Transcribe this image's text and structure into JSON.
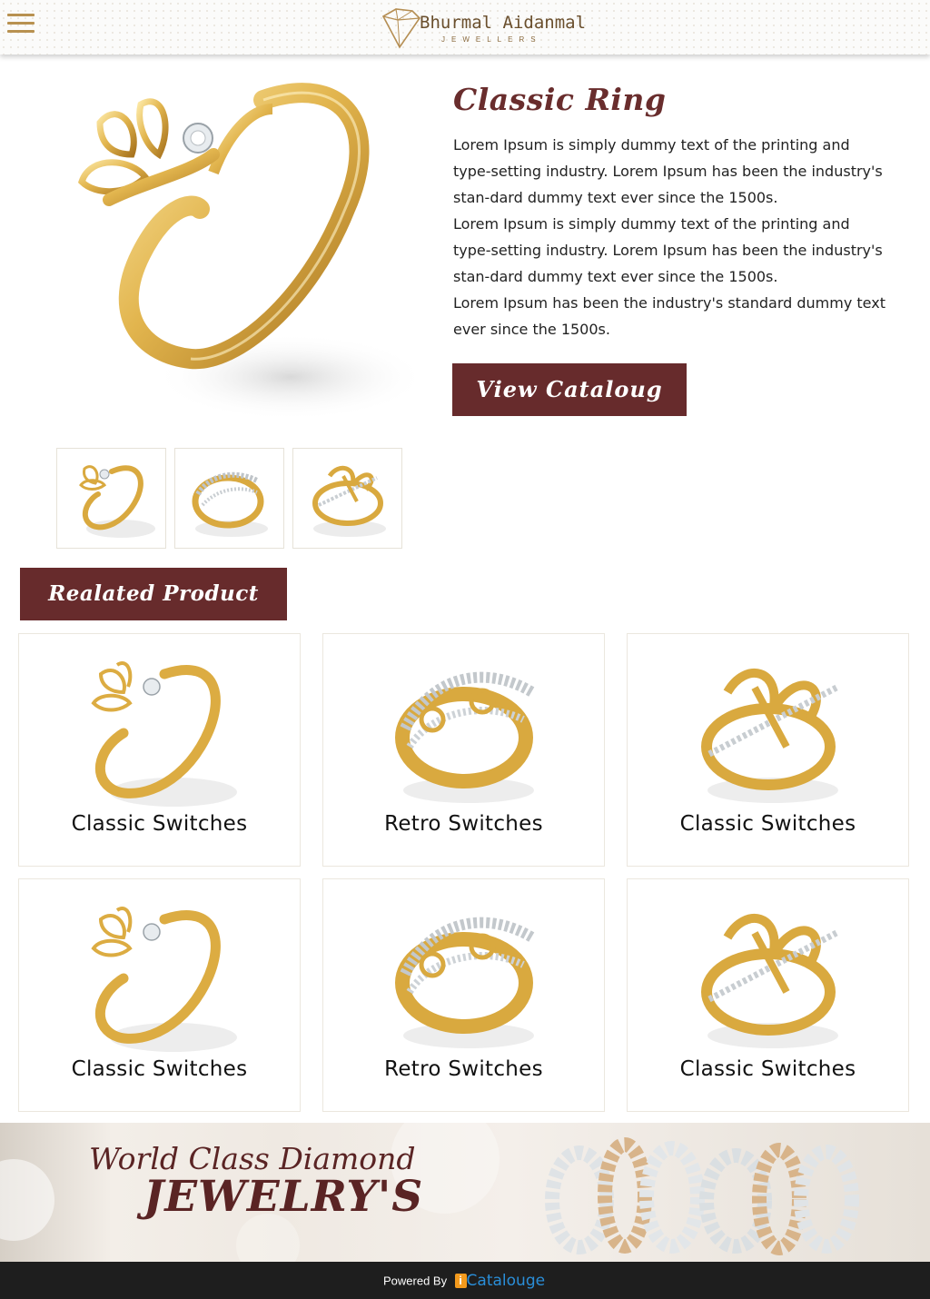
{
  "header": {
    "menu_icon": "hamburger-icon",
    "logo_name": "Bhurmal Aidanmal",
    "logo_sub": "JEWELLERS",
    "accent_color": "#b89150"
  },
  "product": {
    "title": "Classic Ring",
    "description": [
      "Lorem Ipsum is simply dummy text of the printing and type-setting industry. Lorem Ipsum has been the industry's stan-dard dummy text ever since the 1500s.",
      "Lorem Ipsum is simply dummy text of the printing and type-setting industry. Lorem Ipsum has been the industry's stan-dard dummy text ever since the 1500s.",
      "Lorem Ipsum has been the industry's standard dummy text ever since the 1500s."
    ],
    "button_label": "View Cataloug",
    "brand_color": "#672b2c"
  },
  "related": {
    "heading": "Realated Product",
    "items": [
      {
        "label": "Classic Switches",
        "icon": "leaf-ring-icon"
      },
      {
        "label": "Retro Switches",
        "icon": "filigree-ring-icon"
      },
      {
        "label": "Classic Switches",
        "icon": "cross-ring-icon"
      },
      {
        "label": "Classic Switches",
        "icon": "leaf-ring-icon"
      },
      {
        "label": "Retro Switches",
        "icon": "filigree-ring-icon"
      },
      {
        "label": "Classic Switches",
        "icon": "cross-ring-icon"
      }
    ]
  },
  "banner": {
    "line1": "World Class Diamond",
    "line2": "JEWELRY'S"
  },
  "footer": {
    "powered_by": "Powered By",
    "brand_i": "i",
    "brand_name": "Catalouge",
    "brand_color": "#2a8ed8"
  }
}
